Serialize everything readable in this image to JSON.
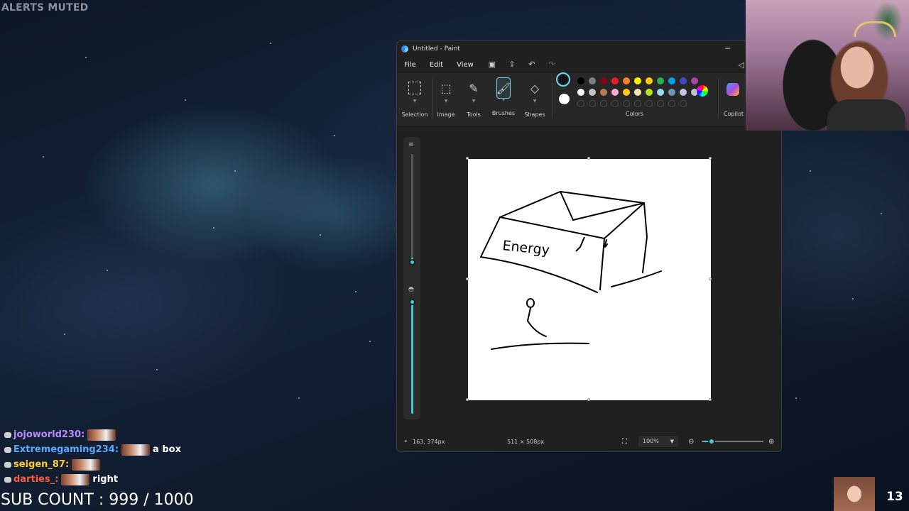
{
  "overlay": {
    "alerts_status": "ALERTS MUTED",
    "sub_count": "SUB COUNT : 999 / 1000",
    "viewer_count": "13"
  },
  "chat": [
    {
      "name": "jojoworld230:",
      "name_color": "#b58cff",
      "message": ""
    },
    {
      "name": "Extremegaming234:",
      "name_color": "#5aa8ff",
      "message": "a box"
    },
    {
      "name": "seigen_87:",
      "name_color": "#ffcc33",
      "message": ""
    },
    {
      "name": "darties_:",
      "name_color": "#ff5a3a",
      "message": "right"
    }
  ],
  "paint": {
    "title": "Untitled - Paint",
    "menu": [
      "File",
      "Edit",
      "View"
    ],
    "tools": [
      {
        "label": "Selection",
        "icon": "selection-icon"
      },
      {
        "label": "Image",
        "icon": "image-icon"
      },
      {
        "label": "Tools",
        "icon": "tools-icon"
      },
      {
        "label": "Brushes",
        "icon": "brush-icon"
      },
      {
        "label": "Shapes",
        "icon": "shapes-icon"
      }
    ],
    "colors_label": "Colors",
    "copilot_label": "Copilot",
    "palette_row1": [
      "#000000",
      "#7f7f7f",
      "#880015",
      "#ed1c24",
      "#ff7f27",
      "#fff200",
      "#ffc90e",
      "#22b14c",
      "#00a2e8",
      "#3f48cc",
      "#a349a4"
    ],
    "palette_row2": [
      "#ffffff",
      "#c3c3c3",
      "#b97a57",
      "#ffaec9",
      "#ffc90e",
      "#efe4b0",
      "#b5e61d",
      "#99d9ea",
      "#7092be",
      "#c8bfe7",
      "#c3c3c3"
    ],
    "primary_color": "#111111",
    "secondary_color": "#ffffff",
    "accent_color": "#40c8d8",
    "canvas_text": "Energy",
    "status": {
      "cursor_pos": "163, 374px",
      "canvas_size": "511 × 508px",
      "zoom": "100%"
    }
  }
}
